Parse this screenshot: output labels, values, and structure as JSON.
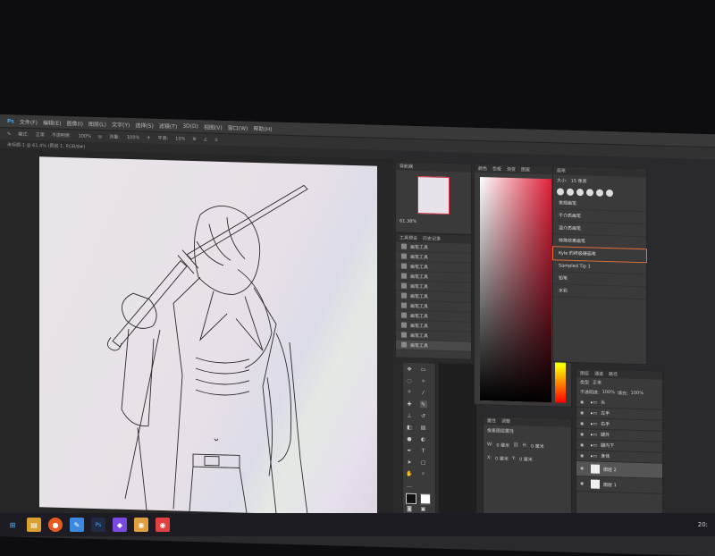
{
  "menubar": {
    "items": [
      "文件(F)",
      "编辑(E)",
      "图像(I)",
      "图层(L)",
      "文字(Y)",
      "选择(S)",
      "滤镜(T)",
      "3D(D)",
      "视图(V)",
      "窗口(W)",
      "帮助(H)"
    ]
  },
  "options": {
    "opacity_label": "不透明度:",
    "opacity_value": "100%",
    "flow_label": "流量:",
    "flow_value": "100%",
    "smooth_label": "平滑:",
    "smooth_value": "10%",
    "mode_label": "模式:",
    "mode_value": "正常"
  },
  "document": {
    "tab": "未标题-1 @ 61.4% (图层 1, RGB/8#)"
  },
  "navigator": {
    "tab": "导航器",
    "zoom": "61.38%"
  },
  "history": {
    "tabs": [
      "工具预设",
      "历史记录"
    ],
    "items": [
      "画笔工具",
      "画笔工具",
      "画笔工具",
      "画笔工具",
      "画笔工具",
      "画笔工具",
      "画笔工具",
      "画笔工具",
      "画笔工具",
      "画笔工具",
      "画笔工具",
      "画笔工具"
    ]
  },
  "color": {
    "tabs": [
      "颜色",
      "色板",
      "渐变",
      "图案"
    ]
  },
  "brushes": {
    "tab": "画笔",
    "size": "15 像素",
    "items": [
      "常规画笔",
      "干介质画笔",
      "湿介质画笔",
      "特殊效果画笔",
      "Kyle 的终极硬画笔",
      "Sampled Tip 1",
      "铅笔",
      "水彩"
    ]
  },
  "properties": {
    "tabs": [
      "属性",
      "调整"
    ],
    "title": "像素图层属性",
    "w_label": "W:",
    "w_value": "0 厘米",
    "h_label": "H:",
    "h_value": "0 厘米",
    "x_label": "X:",
    "x_value": "0 厘米",
    "y_label": "Y:",
    "y_value": "0 厘米"
  },
  "layers": {
    "tabs": [
      "图层",
      "通道",
      "路径"
    ],
    "kind": "类型",
    "mode": "正常",
    "opacity_label": "不透明度:",
    "opacity": "100%",
    "fill_label": "填充:",
    "fill": "100%",
    "items": [
      "头",
      "左手",
      "右手",
      "腿外",
      "腿内下",
      "身体",
      "图层 2",
      "图层 1"
    ]
  },
  "taskbar": {
    "apps": [
      "win",
      "search",
      "files",
      "firefox",
      "sketch",
      "ps",
      "app1",
      "app2",
      "app3"
    ],
    "time": "20:"
  },
  "colors": {
    "accent_red": "#e0203a",
    "bg_dark": "#2a2a2c"
  }
}
